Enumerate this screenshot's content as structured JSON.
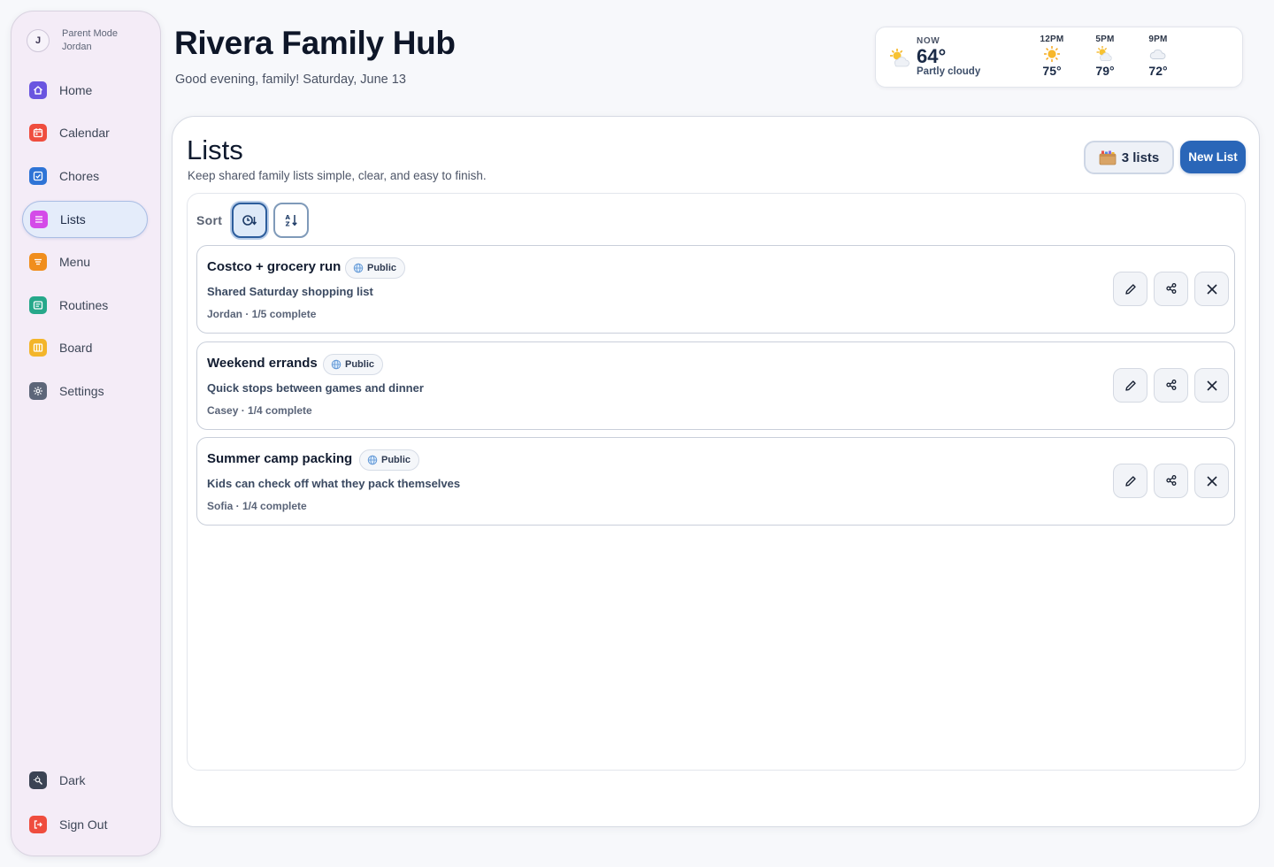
{
  "app": {
    "title": "Rivera Family Hub",
    "greeting": "Good evening, family! Saturday, June 13"
  },
  "profile": {
    "initial": "J",
    "mode": "Parent Mode",
    "name": "Jordan"
  },
  "sidebar": {
    "items": [
      {
        "label": "Home",
        "icon": "home-icon",
        "color": "#6a55e0"
      },
      {
        "label": "Calendar",
        "icon": "calendar-icon",
        "color": "#ef4d3e"
      },
      {
        "label": "Chores",
        "icon": "checkbox-icon",
        "color": "#2e74d6"
      },
      {
        "label": "Lists",
        "icon": "list-icon",
        "color": "#d44be8",
        "active": true
      },
      {
        "label": "Menu",
        "icon": "menu-icon",
        "color": "#f08e1d"
      },
      {
        "label": "Routines",
        "icon": "routine-icon",
        "color": "#26a88a"
      },
      {
        "label": "Board",
        "icon": "board-icon",
        "color": "#f3b52a"
      },
      {
        "label": "Settings",
        "icon": "gear-icon",
        "color": "#5d6679"
      }
    ],
    "bottom": [
      {
        "label": "Dark",
        "icon": "theme-toggle-icon",
        "color": "#3b4354"
      },
      {
        "label": "Sign Out",
        "icon": "sign-out-icon",
        "color": "#ef4d3e"
      }
    ]
  },
  "weather": {
    "now_label": "NOW",
    "now_temp": "64°",
    "now_desc": "Partly cloudy",
    "now_icon": "partly-cloudy-icon",
    "hours": [
      {
        "label": "12PM",
        "icon": "sun-icon",
        "temp": "75°"
      },
      {
        "label": "5PM",
        "icon": "partly-cloudy-icon",
        "temp": "79°"
      },
      {
        "label": "9PM",
        "icon": "cloud-icon",
        "temp": "72°"
      }
    ]
  },
  "lists_page": {
    "title": "Lists",
    "description": "Keep shared family lists simple, clear, and easy to finish.",
    "count_label": "3 lists",
    "new_list_label": "New List",
    "sort_label": "Sort",
    "sort_options": [
      {
        "icon": "sort-recent-icon",
        "active": true
      },
      {
        "icon": "sort-alpha-icon",
        "active": false
      }
    ],
    "lists": [
      {
        "title": "Costco + grocery run",
        "visibility": "Public",
        "description": "Shared Saturday shopping list",
        "meta": "Jordan · 1/5 complete"
      },
      {
        "title": "Weekend errands",
        "visibility": "Public",
        "description": "Quick stops between games and dinner",
        "meta": "Casey · 1/4 complete"
      },
      {
        "title": "Summer camp packing",
        "visibility": "Public",
        "description": "Kids can check off what they pack themselves",
        "meta": "Sofia · 1/4 complete"
      }
    ]
  }
}
